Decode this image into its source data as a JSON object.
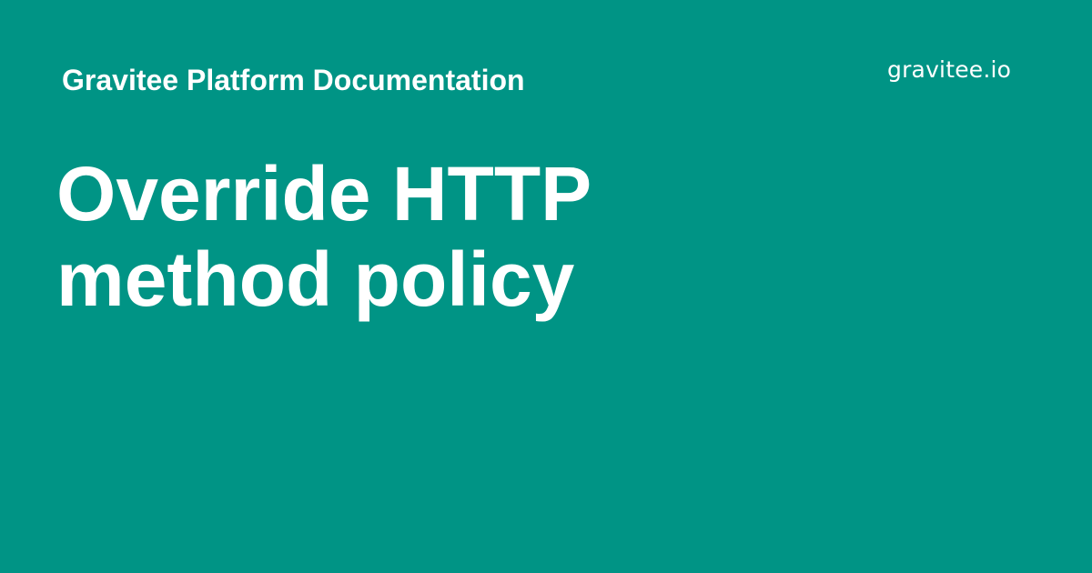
{
  "colors": {
    "background": "#009485",
    "text": "#ffffff"
  },
  "header": {
    "site_title": "Gravitee Platform Documentation",
    "logo_text": "gravitee.io"
  },
  "main": {
    "title_lines": [
      "Override HTTP",
      "method policy"
    ]
  }
}
